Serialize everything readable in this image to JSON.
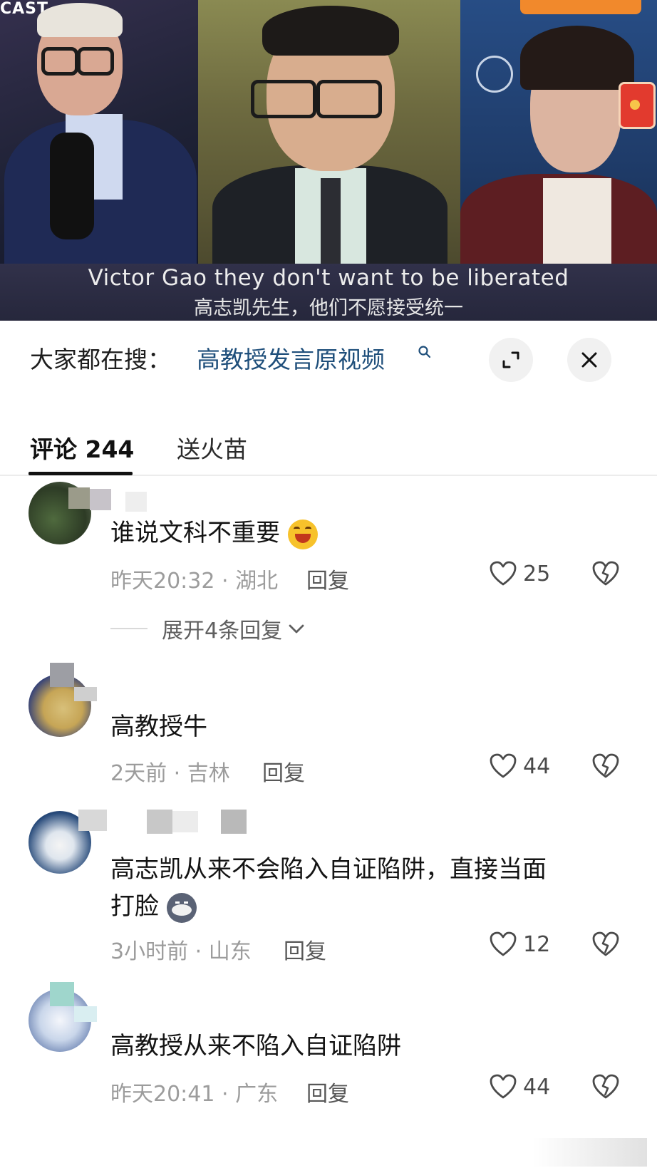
{
  "video": {
    "brand_corner": "CAST",
    "subtitle_en": "Victor Gao they don't want to be liberated",
    "subtitle_zh": "高志凯先生，他们不愿接受统一"
  },
  "sheet": {
    "search_prefix": "大家都在搜：",
    "search_query": "高教授发言原视频",
    "expand_icon": "expand-icon",
    "close_icon": "close-icon"
  },
  "tabs": {
    "comments_label": "评论 244",
    "gifts_label": "送火苗"
  },
  "comments": [
    {
      "text": "谁说文科不重要",
      "time": "昨天20:32",
      "region": "湖北",
      "reply": "回复",
      "likes": "25",
      "expand_label": "展开4条回复"
    },
    {
      "text": "高教授牛",
      "time": "2天前",
      "region": "吉林",
      "reply": "回复",
      "likes": "44"
    },
    {
      "text_line1": "高志凯从来不会陷入自证陷阱，直接当面",
      "text_line2": "打脸",
      "time": "3小时前",
      "region": "山东",
      "reply": "回复",
      "likes": "12"
    },
    {
      "text": "高教授从来不陷入自证陷阱",
      "time": "昨天20:41",
      "region": "广东",
      "reply": "回复",
      "likes": "44"
    }
  ],
  "colors": {
    "link": "#1f4f7b",
    "meta": "#9c9c9c",
    "text": "#141414"
  }
}
